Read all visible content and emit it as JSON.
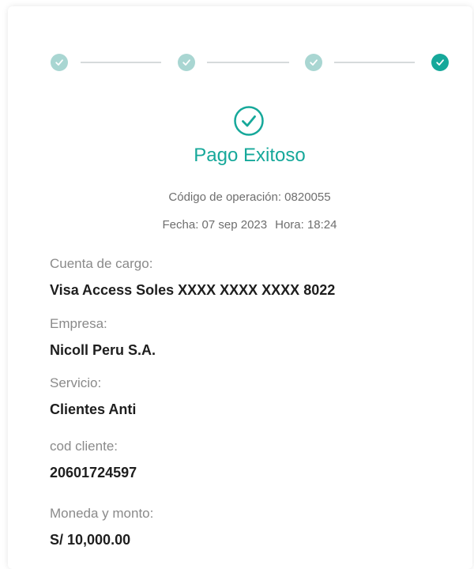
{
  "colors": {
    "accent": "#16a89a",
    "accent_light": "#a9d6d2"
  },
  "stepper": {
    "steps": [
      {
        "state": "completed",
        "icon": "check-icon"
      },
      {
        "state": "completed",
        "icon": "check-icon"
      },
      {
        "state": "completed",
        "icon": "check-icon"
      },
      {
        "state": "current",
        "icon": "check-icon"
      }
    ]
  },
  "result": {
    "icon": "check-circle-icon",
    "title": "Pago Exitoso",
    "operation_code": "Código de operación: 0820055",
    "date": "Fecha: 07 sep 2023",
    "time": "Hora: 18:24"
  },
  "details": [
    {
      "label": "Cuenta de cargo:",
      "value": "Visa Access Soles XXXX XXXX XXXX 8022"
    },
    {
      "label": "Empresa:",
      "value": "Nicoll Peru S.A."
    },
    {
      "label": "Servicio:",
      "value": "Clientes Anti"
    },
    {
      "label": "cod cliente:",
      "value": "20601724597"
    },
    {
      "label": "Moneda y monto:",
      "value": "S/ 10,000.00"
    }
  ]
}
